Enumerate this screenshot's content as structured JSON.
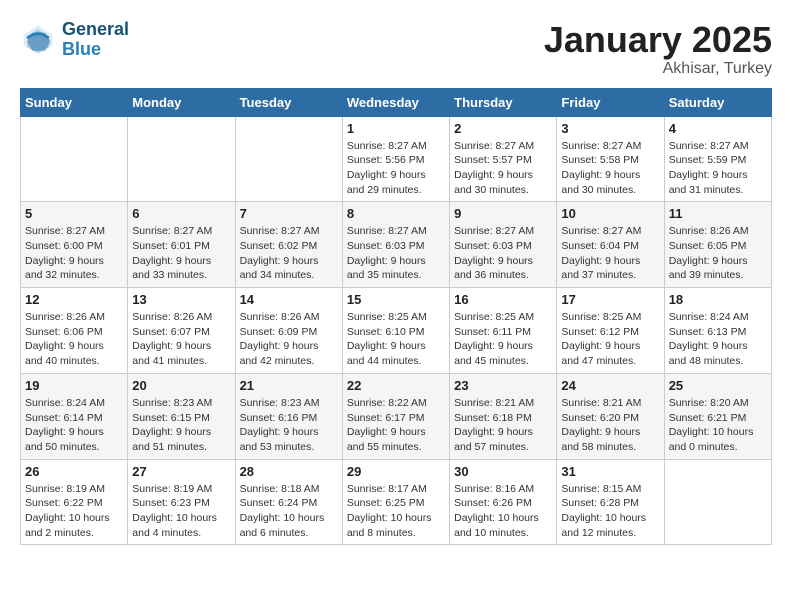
{
  "header": {
    "logo_line1": "General",
    "logo_line2": "Blue",
    "month": "January 2025",
    "location": "Akhisar, Turkey"
  },
  "weekdays": [
    "Sunday",
    "Monday",
    "Tuesday",
    "Wednesday",
    "Thursday",
    "Friday",
    "Saturday"
  ],
  "weeks": [
    [
      {
        "day": "",
        "info": ""
      },
      {
        "day": "",
        "info": ""
      },
      {
        "day": "",
        "info": ""
      },
      {
        "day": "1",
        "info": "Sunrise: 8:27 AM\nSunset: 5:56 PM\nDaylight: 9 hours\nand 29 minutes."
      },
      {
        "day": "2",
        "info": "Sunrise: 8:27 AM\nSunset: 5:57 PM\nDaylight: 9 hours\nand 30 minutes."
      },
      {
        "day": "3",
        "info": "Sunrise: 8:27 AM\nSunset: 5:58 PM\nDaylight: 9 hours\nand 30 minutes."
      },
      {
        "day": "4",
        "info": "Sunrise: 8:27 AM\nSunset: 5:59 PM\nDaylight: 9 hours\nand 31 minutes."
      }
    ],
    [
      {
        "day": "5",
        "info": "Sunrise: 8:27 AM\nSunset: 6:00 PM\nDaylight: 9 hours\nand 32 minutes."
      },
      {
        "day": "6",
        "info": "Sunrise: 8:27 AM\nSunset: 6:01 PM\nDaylight: 9 hours\nand 33 minutes."
      },
      {
        "day": "7",
        "info": "Sunrise: 8:27 AM\nSunset: 6:02 PM\nDaylight: 9 hours\nand 34 minutes."
      },
      {
        "day": "8",
        "info": "Sunrise: 8:27 AM\nSunset: 6:03 PM\nDaylight: 9 hours\nand 35 minutes."
      },
      {
        "day": "9",
        "info": "Sunrise: 8:27 AM\nSunset: 6:03 PM\nDaylight: 9 hours\nand 36 minutes."
      },
      {
        "day": "10",
        "info": "Sunrise: 8:27 AM\nSunset: 6:04 PM\nDaylight: 9 hours\nand 37 minutes."
      },
      {
        "day": "11",
        "info": "Sunrise: 8:26 AM\nSunset: 6:05 PM\nDaylight: 9 hours\nand 39 minutes."
      }
    ],
    [
      {
        "day": "12",
        "info": "Sunrise: 8:26 AM\nSunset: 6:06 PM\nDaylight: 9 hours\nand 40 minutes."
      },
      {
        "day": "13",
        "info": "Sunrise: 8:26 AM\nSunset: 6:07 PM\nDaylight: 9 hours\nand 41 minutes."
      },
      {
        "day": "14",
        "info": "Sunrise: 8:26 AM\nSunset: 6:09 PM\nDaylight: 9 hours\nand 42 minutes."
      },
      {
        "day": "15",
        "info": "Sunrise: 8:25 AM\nSunset: 6:10 PM\nDaylight: 9 hours\nand 44 minutes."
      },
      {
        "day": "16",
        "info": "Sunrise: 8:25 AM\nSunset: 6:11 PM\nDaylight: 9 hours\nand 45 minutes."
      },
      {
        "day": "17",
        "info": "Sunrise: 8:25 AM\nSunset: 6:12 PM\nDaylight: 9 hours\nand 47 minutes."
      },
      {
        "day": "18",
        "info": "Sunrise: 8:24 AM\nSunset: 6:13 PM\nDaylight: 9 hours\nand 48 minutes."
      }
    ],
    [
      {
        "day": "19",
        "info": "Sunrise: 8:24 AM\nSunset: 6:14 PM\nDaylight: 9 hours\nand 50 minutes."
      },
      {
        "day": "20",
        "info": "Sunrise: 8:23 AM\nSunset: 6:15 PM\nDaylight: 9 hours\nand 51 minutes."
      },
      {
        "day": "21",
        "info": "Sunrise: 8:23 AM\nSunset: 6:16 PM\nDaylight: 9 hours\nand 53 minutes."
      },
      {
        "day": "22",
        "info": "Sunrise: 8:22 AM\nSunset: 6:17 PM\nDaylight: 9 hours\nand 55 minutes."
      },
      {
        "day": "23",
        "info": "Sunrise: 8:21 AM\nSunset: 6:18 PM\nDaylight: 9 hours\nand 57 minutes."
      },
      {
        "day": "24",
        "info": "Sunrise: 8:21 AM\nSunset: 6:20 PM\nDaylight: 9 hours\nand 58 minutes."
      },
      {
        "day": "25",
        "info": "Sunrise: 8:20 AM\nSunset: 6:21 PM\nDaylight: 10 hours\nand 0 minutes."
      }
    ],
    [
      {
        "day": "26",
        "info": "Sunrise: 8:19 AM\nSunset: 6:22 PM\nDaylight: 10 hours\nand 2 minutes."
      },
      {
        "day": "27",
        "info": "Sunrise: 8:19 AM\nSunset: 6:23 PM\nDaylight: 10 hours\nand 4 minutes."
      },
      {
        "day": "28",
        "info": "Sunrise: 8:18 AM\nSunset: 6:24 PM\nDaylight: 10 hours\nand 6 minutes."
      },
      {
        "day": "29",
        "info": "Sunrise: 8:17 AM\nSunset: 6:25 PM\nDaylight: 10 hours\nand 8 minutes."
      },
      {
        "day": "30",
        "info": "Sunrise: 8:16 AM\nSunset: 6:26 PM\nDaylight: 10 hours\nand 10 minutes."
      },
      {
        "day": "31",
        "info": "Sunrise: 8:15 AM\nSunset: 6:28 PM\nDaylight: 10 hours\nand 12 minutes."
      },
      {
        "day": "",
        "info": ""
      }
    ]
  ]
}
